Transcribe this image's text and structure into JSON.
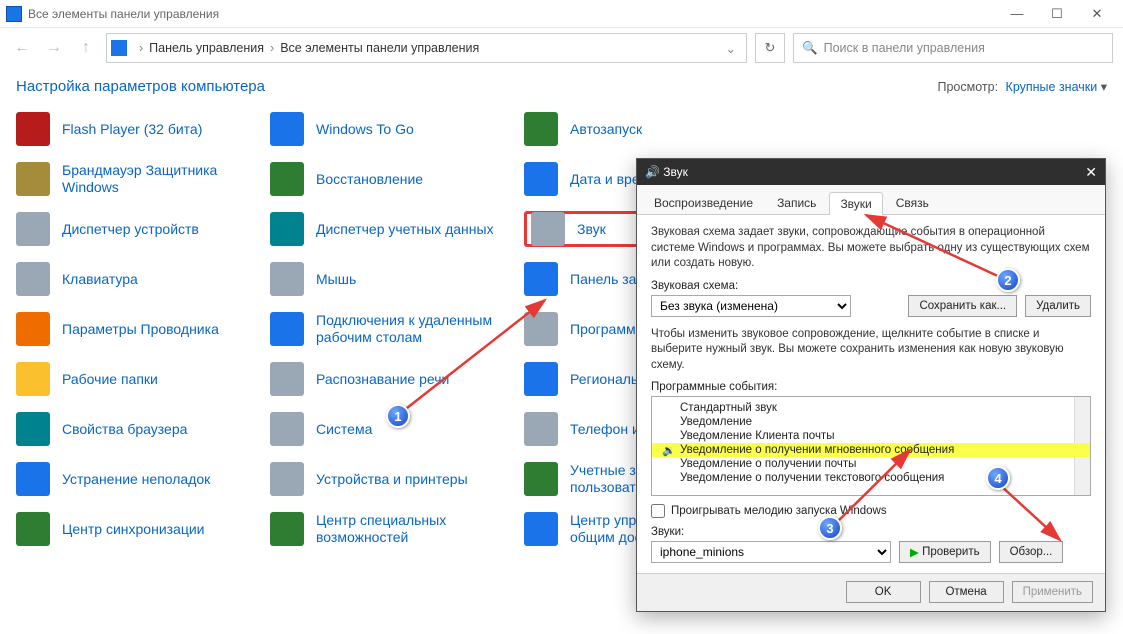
{
  "titlebar": {
    "title": "Все элементы панели управления"
  },
  "breadcrumb": {
    "root": "Панель управления",
    "current": "Все элементы панели управления"
  },
  "search": {
    "placeholder": "Поиск в панели управления"
  },
  "header": {
    "title": "Настройка параметров компьютера",
    "view_label": "Просмотр:",
    "view_mode": "Крупные значки"
  },
  "items": [
    [
      {
        "l": "Flash Player (32 бита)",
        "c": "ic-red"
      },
      {
        "l": "Windows To Go",
        "c": "ic-blue"
      },
      {
        "l": "Автозапуск",
        "c": "ic-green"
      }
    ],
    [
      {
        "l": "Брандмауэр Защитника Windows",
        "c": "ic-khaki"
      },
      {
        "l": "Восстановление",
        "c": "ic-green"
      },
      {
        "l": "Дата и время",
        "c": "ic-blue"
      }
    ],
    [
      {
        "l": "Диспетчер устройств",
        "c": "ic-grey"
      },
      {
        "l": "Диспетчер учетных данных",
        "c": "ic-teal"
      },
      {
        "l": "Звук",
        "c": "ic-grey",
        "hl": true
      }
    ],
    [
      {
        "l": "Клавиатура",
        "c": "ic-grey"
      },
      {
        "l": "Мышь",
        "c": "ic-grey"
      },
      {
        "l": "Панель задач и навигация",
        "c": "ic-blue"
      }
    ],
    [
      {
        "l": "Параметры Проводника",
        "c": "ic-orange"
      },
      {
        "l": "Подключения к удаленным рабочим столам",
        "c": "ic-blue"
      },
      {
        "l": "Программы и компоненты",
        "c": "ic-grey"
      }
    ],
    [
      {
        "l": "Рабочие папки",
        "c": "ic-yellow"
      },
      {
        "l": "Распознавание речи",
        "c": "ic-grey"
      },
      {
        "l": "Региональные стандарты",
        "c": "ic-blue"
      }
    ],
    [
      {
        "l": "Свойства браузера",
        "c": "ic-teal"
      },
      {
        "l": "Система",
        "c": "ic-grey"
      },
      {
        "l": "Телефон и модем",
        "c": "ic-grey"
      }
    ],
    [
      {
        "l": "Устранение неполадок",
        "c": "ic-blue"
      },
      {
        "l": "Устройства и принтеры",
        "c": "ic-grey"
      },
      {
        "l": "Учетные записи пользователей",
        "c": "ic-green"
      }
    ],
    [
      {
        "l": "Центр синхронизации",
        "c": "ic-green"
      },
      {
        "l": "Центр специальных возможностей",
        "c": "ic-green"
      },
      {
        "l": "Центр управления сетями и общим доступом",
        "c": "ic-blue"
      }
    ]
  ],
  "dialog": {
    "title": "Звук",
    "tabs": [
      "Воспроизведение",
      "Запись",
      "Звуки",
      "Связь"
    ],
    "active_tab": 2,
    "desc": "Звуковая схема задает звуки, сопровождающие события в операционной системе Windows и программах. Вы можете выбрать одну из существующих схем или создать новую.",
    "scheme_label": "Звуковая схема:",
    "scheme_value": "Без звука (изменена)",
    "save_as": "Сохранить как...",
    "delete": "Удалить",
    "desc2": "Чтобы изменить звуковое сопровождение, щелкните событие в списке и выберите нужный звук. Вы можете сохранить изменения как новую звуковую схему.",
    "events_label": "Программные события:",
    "events": [
      {
        "t": "Стандартный звук"
      },
      {
        "t": "Уведомление"
      },
      {
        "t": "Уведомление Клиента почты"
      },
      {
        "t": "Уведомление о получении мгновенного сообщения",
        "hl": true,
        "spk": true
      },
      {
        "t": "Уведомление о получении почты"
      },
      {
        "t": "Уведомление о получении текстового сообщения"
      }
    ],
    "play_startup": "Проигрывать мелодию запуска Windows",
    "sounds_label": "Звуки:",
    "sound_value": "iphone_minions",
    "test": "Проверить",
    "browse": "Обзор...",
    "ok": "OK",
    "cancel": "Отмена",
    "apply": "Применить"
  },
  "markers": {
    "m1": "1",
    "m2": "2",
    "m3": "3",
    "m4": "4"
  }
}
